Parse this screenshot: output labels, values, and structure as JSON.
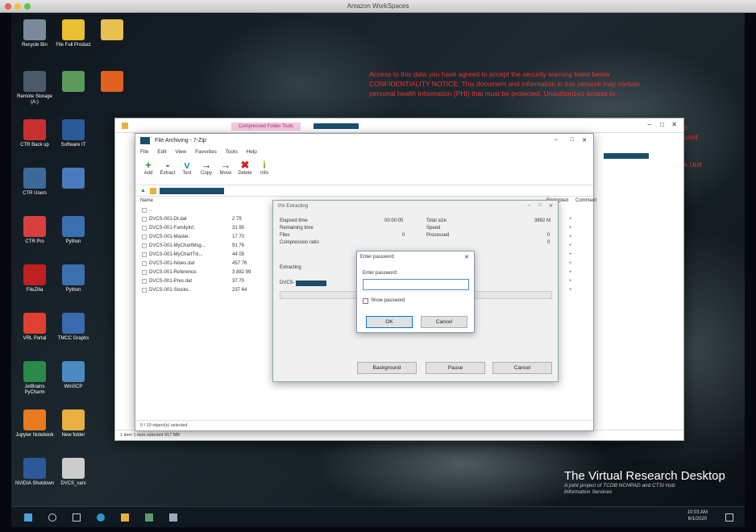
{
  "window_title": "Amazon WorkSpaces",
  "desktop": {
    "icons": [
      {
        "label": "Recycle Bin",
        "color": "#7a8a9a"
      },
      {
        "label": "File Full Product",
        "color": "#e8c030"
      },
      {
        "label": "",
        "color": "#e8c050"
      },
      {
        "label": "Remote Storage (A:)",
        "color": "#4a5a6a"
      },
      {
        "label": "",
        "color": "#5a9a5a"
      },
      {
        "label": "",
        "color": "#e06020"
      },
      {
        "label": "CTR Back up",
        "color": "#c83030"
      },
      {
        "label": "Software IT",
        "color": "#2a5a9a"
      },
      {
        "label": "CTR Users",
        "color": "#3a6a9a"
      },
      {
        "label": "",
        "color": "#4a7ac0"
      },
      {
        "label": "CTR Pro",
        "color": "#d84040"
      },
      {
        "label": "Python",
        "color": "#3a70b0"
      },
      {
        "label": "FileZilla",
        "color": "#c02020"
      },
      {
        "label": "Python",
        "color": "#3a70b0"
      },
      {
        "label": "VRL Portal",
        "color": "#e04030"
      },
      {
        "label": "TMCC Graphs",
        "color": "#3a6ab0"
      },
      {
        "label": "JetBrains PyCharm",
        "color": "#2a8a4a"
      },
      {
        "label": "WinSCP",
        "color": "#4a8ac0"
      },
      {
        "label": "Jupyter Notebook",
        "color": "#e87a20"
      },
      {
        "label": "New folder",
        "color": "#e8b040"
      },
      {
        "label": "NVIDIA Shutdown",
        "color": "#2a5a9a"
      },
      {
        "label": "DVCS_vars",
        "color": "#cccccc"
      }
    ]
  },
  "warning": {
    "lines": [
      "Access to this data you have agreed to accept the security warning listed below",
      "CONFIDENTIALITY NOTICE: This document and information in this network may contain",
      "personal health information (PHI) that must be protected. Unauthorized access to",
      "",
      "",
      "",
      ""
    ],
    "side": [
      "files",
      "located",
      "",
      "Use Unit"
    ]
  },
  "brand": {
    "title": "The Virtual Research Desktop",
    "line1": "A joint project of TCDB NCHPAD and CTSI Hub",
    "line2": "Information Services"
  },
  "explorer": {
    "pink_tab": "Compressed Folder Tools"
  },
  "zip": {
    "title": "File Archiving - 7-Zip",
    "menu": [
      "File",
      "Edit",
      "View",
      "Favorites",
      "Tools",
      "Help"
    ],
    "toolbar": [
      {
        "label": "Add",
        "glyph": "+",
        "color": "#1a9a3a"
      },
      {
        "label": "Extract",
        "glyph": "-",
        "color": "#2a3a9a"
      },
      {
        "label": "Test",
        "glyph": "v",
        "color": "#2aa0c0"
      },
      {
        "label": "Copy",
        "glyph": "→",
        "color": "#333"
      },
      {
        "label": "Move",
        "glyph": "→",
        "color": "#2a4a9a"
      },
      {
        "label": "Delete",
        "glyph": "✖",
        "color": "#d02020"
      },
      {
        "label": "Info",
        "glyph": "i",
        "color": "#b0a020"
      }
    ],
    "col_name": "Name",
    "col_encrypted": "Encrypted",
    "col_comment": "Comment",
    "rows": [
      {
        "name": "..",
        "size": "",
        "enc": ""
      },
      {
        "name": "DVCS-001-Dt.dat",
        "size": "2 79",
        "enc": "+"
      },
      {
        "name": "DVCS-001-FamilyInf.",
        "size": "31 95",
        "enc": "+"
      },
      {
        "name": "DVCS-001-Master.",
        "size": "17 70",
        "enc": "+"
      },
      {
        "name": "DVCS-001-MyChartMsg...",
        "size": "91 76",
        "enc": "+"
      },
      {
        "name": "DVCS-001-MyChartTxt...",
        "size": "44 05",
        "enc": "+"
      },
      {
        "name": "DVCS-001-Notes.dat",
        "size": "457 76",
        "enc": "+"
      },
      {
        "name": "DVCS-001-Reference.",
        "size": "3 882 99",
        "enc": "+"
      },
      {
        "name": "DVCS-001-Pres.dat",
        "size": "37 70",
        "enc": "+"
      },
      {
        "name": "DVCS-001-Stocks.",
        "size": "237 64",
        "enc": "+"
      }
    ],
    "status": "0 / 10 object(s) selected",
    "explorer_status": "1 item   1 item selected  917 MB"
  },
  "extract": {
    "title": "0% Extracting",
    "elapsed_label": "Elapsed time",
    "elapsed": "00:00:05",
    "remaining_label": "Remaining time",
    "files_label": "Files",
    "files": "0",
    "ratio_label": "Compression ratio",
    "total_label": "Total size",
    "total": "3882 M",
    "speed_label": "Speed",
    "processed_label": "Processed",
    "processed": "0",
    "extra": "0",
    "extracting_label": "Extracting",
    "file_prefix": "DVCS-",
    "buttons": [
      "Background",
      "Pause",
      "Cancel"
    ]
  },
  "password": {
    "title": "Enter password",
    "field_label": "Enter password:",
    "value": "",
    "show_label": "Show password",
    "ok": "OK",
    "cancel": "Cancel"
  },
  "taskbar": {
    "time": "10:03 AM",
    "date": "6/1/2020"
  }
}
